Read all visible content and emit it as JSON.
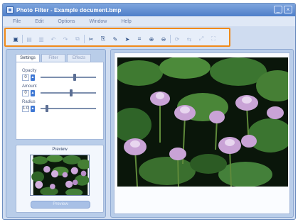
{
  "app": {
    "title": "Photo Filter - Example document.bmp",
    "minimize_glyph": "_",
    "close_glyph": "×"
  },
  "menu": {
    "items": [
      "File",
      "Edit",
      "Options",
      "Window",
      "Help"
    ]
  },
  "toolbar": {
    "tools": [
      {
        "icon": "open-icon",
        "glyph": "▣",
        "faint": false
      },
      {
        "icon": "save-icon",
        "glyph": "▤",
        "faint": true
      },
      {
        "icon": "print-icon",
        "glyph": "▥",
        "faint": true
      },
      {
        "icon": "undo-icon",
        "glyph": "↶",
        "faint": true
      },
      {
        "icon": "redo-icon",
        "glyph": "↷",
        "faint": true
      },
      {
        "icon": "copy-icon",
        "glyph": "⧉",
        "faint": true
      },
      {
        "icon": "cut-icon",
        "glyph": "✂",
        "faint": false
      },
      {
        "icon": "paste-icon",
        "glyph": "⎘",
        "faint": false
      },
      {
        "icon": "brush-icon",
        "glyph": "✎",
        "faint": false
      },
      {
        "icon": "pointer-icon",
        "glyph": "➤",
        "faint": false
      },
      {
        "icon": "crop-icon",
        "glyph": "⌗",
        "faint": false
      },
      {
        "icon": "zoom-in-icon",
        "glyph": "⊕",
        "faint": false
      },
      {
        "icon": "zoom-out-icon",
        "glyph": "⊖",
        "faint": false
      },
      {
        "icon": "rotate-icon",
        "glyph": "⟳",
        "faint": true
      },
      {
        "icon": "flip-icon",
        "glyph": "⇆",
        "faint": true
      },
      {
        "icon": "resize-icon",
        "glyph": "⤢",
        "faint": true
      },
      {
        "icon": "fit-icon",
        "glyph": "⛶",
        "faint": true
      }
    ]
  },
  "adjust": {
    "tabs": [
      "Settings",
      "Filter",
      "Effects"
    ],
    "sliders": [
      {
        "label": "Opacity",
        "value": "0",
        "level": 0.62
      },
      {
        "label": "Amount",
        "value": "0",
        "level": 0.55
      },
      {
        "label": "Radius",
        "value": "1.0",
        "level": 0.1
      }
    ]
  },
  "preview": {
    "title": "Preview",
    "button_label": "Preview"
  },
  "colors": {
    "accent": "#f08a1a",
    "titlebar": "#4e7ec9",
    "panel": "#b9cde9"
  }
}
